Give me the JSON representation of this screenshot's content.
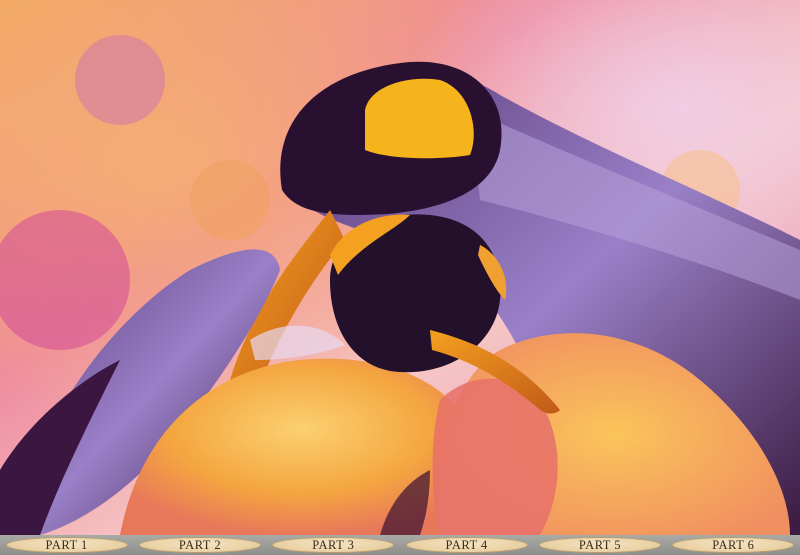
{
  "image": {
    "subject": "two-penguins-painting",
    "palette": {
      "background_pink": "#e070b0",
      "background_orange": "#f0a860",
      "penguin_dark": "#2a1030",
      "penguin_purple": "#8a6ab8",
      "yellow_patch": "#f5b41c",
      "chest_orange": "#f4a640",
      "bar_gray": "#9a9a96",
      "button_cream": "#ead2a6"
    }
  },
  "parts": [
    {
      "label": "PART 1"
    },
    {
      "label": "PART 2"
    },
    {
      "label": "PART 3"
    },
    {
      "label": "PART 4"
    },
    {
      "label": "PART 5"
    },
    {
      "label": "PART 6"
    }
  ]
}
